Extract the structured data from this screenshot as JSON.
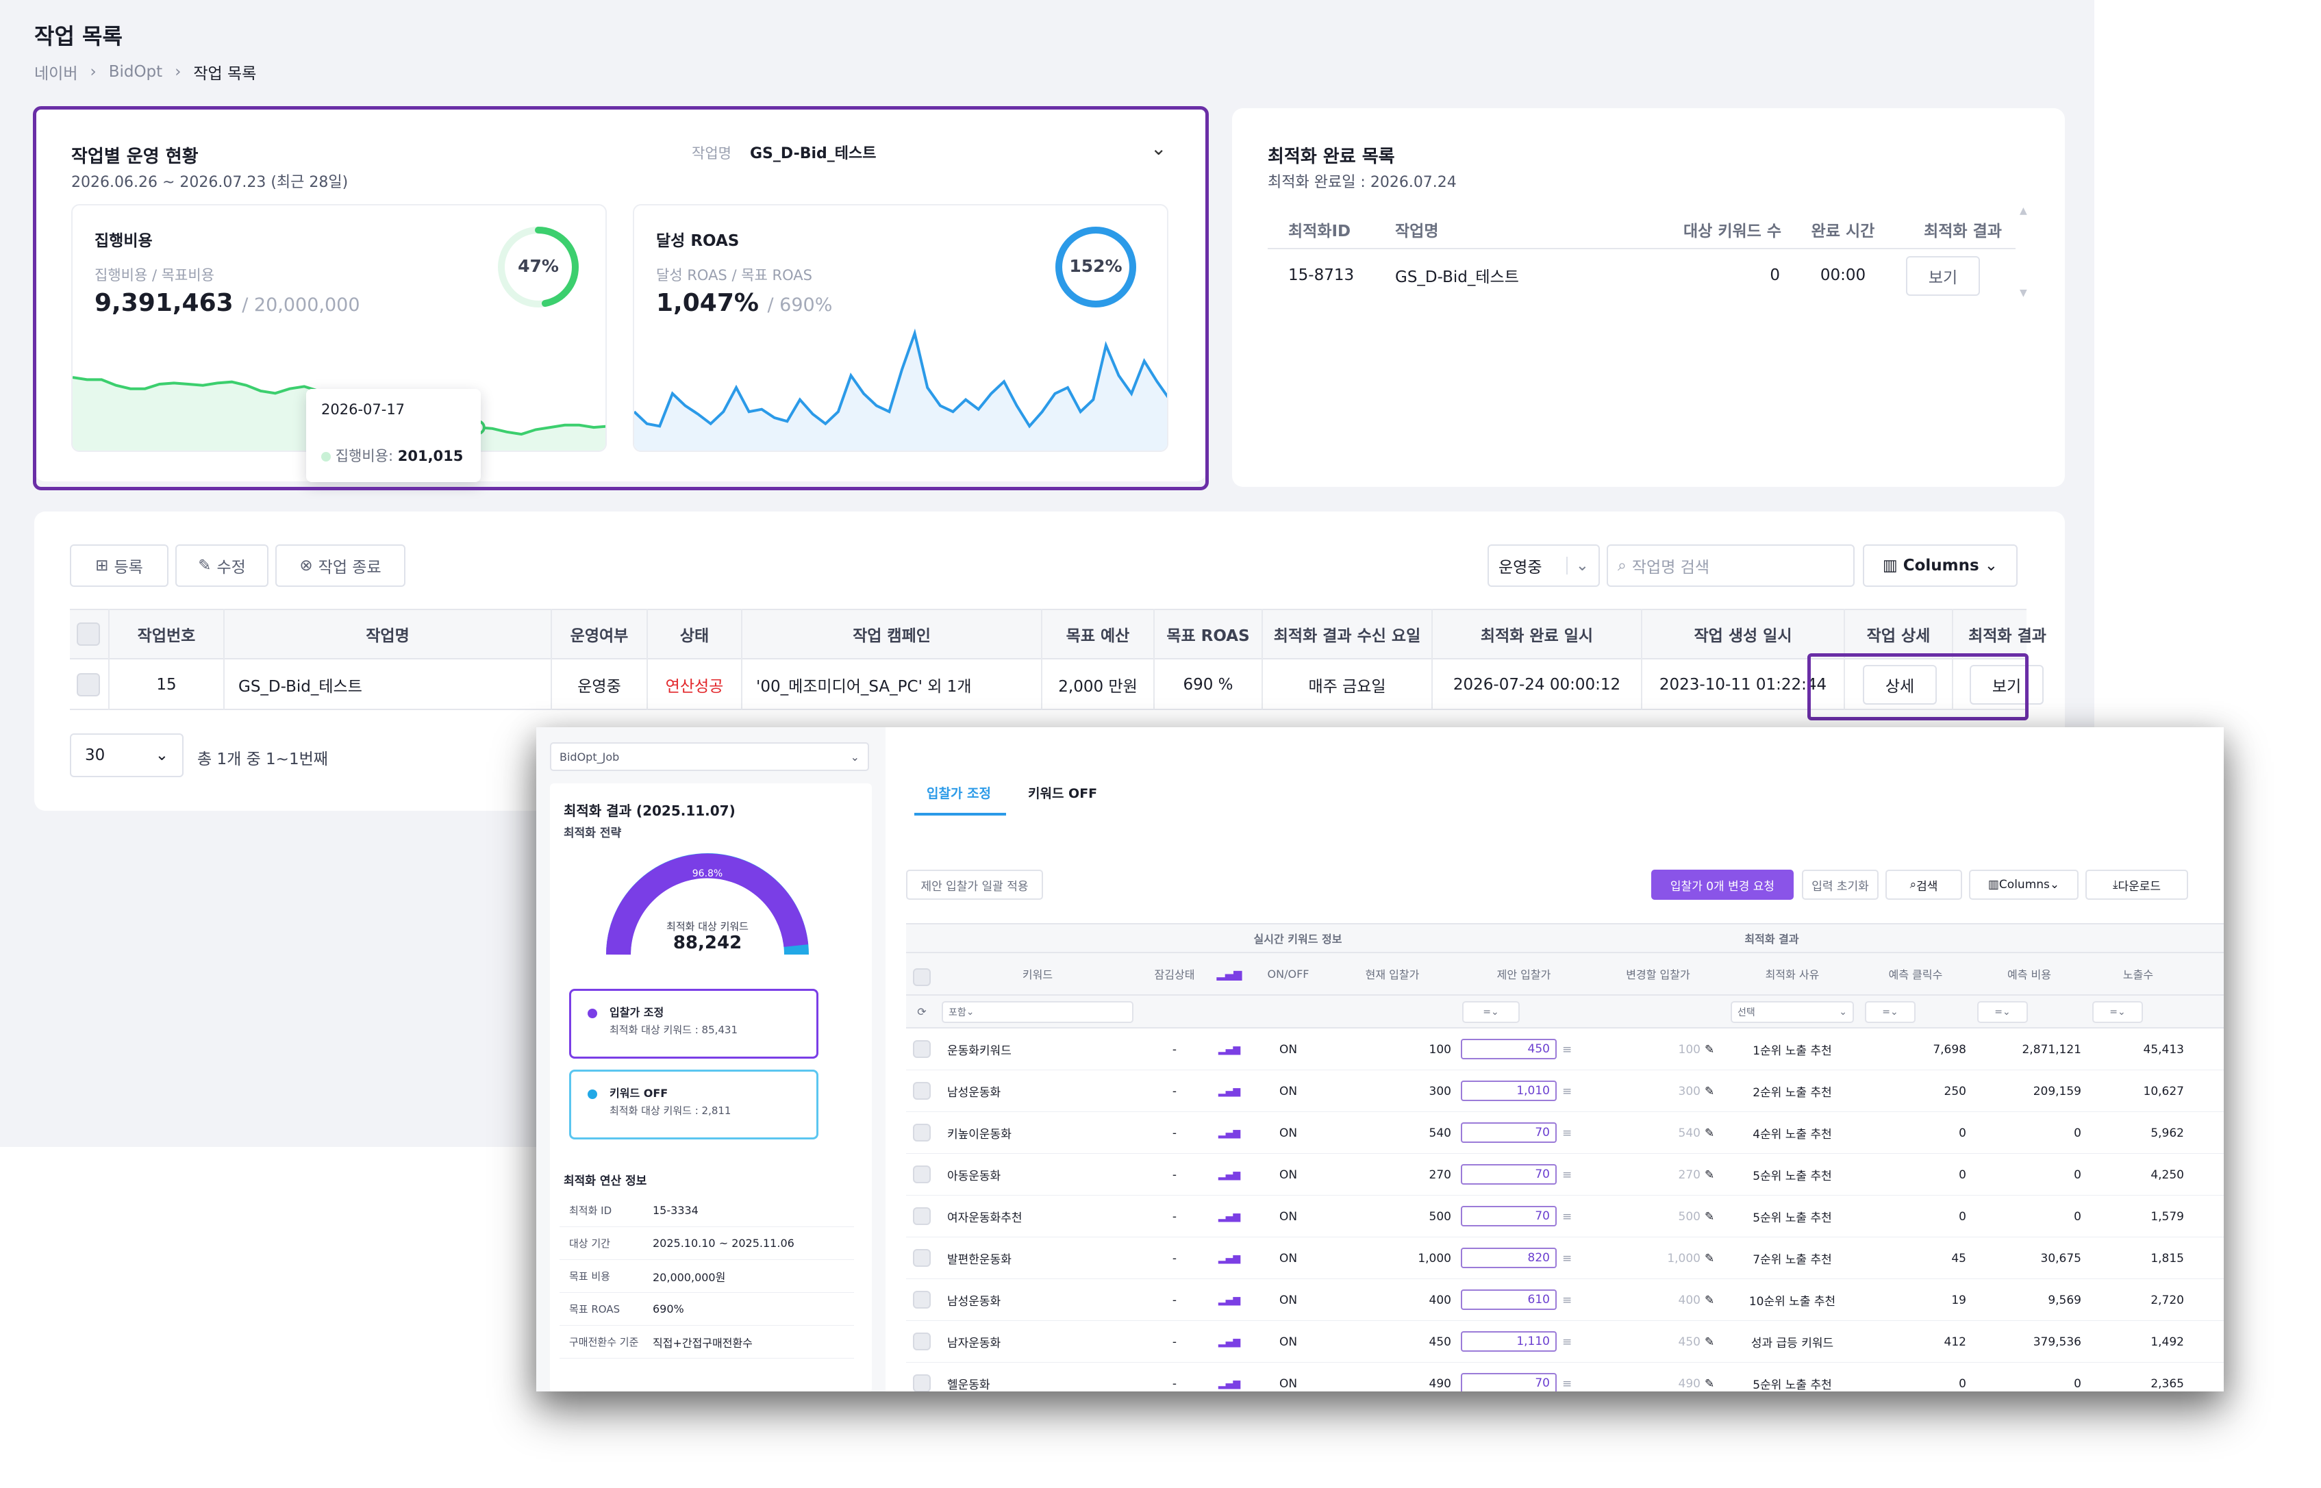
{
  "page": {
    "title": "작업 목록",
    "breadcrumb": [
      "네이버",
      "BidOpt",
      "작업 목록"
    ]
  },
  "status_card": {
    "title": "작업별 운영 현황",
    "period": "2026.06.26 ~ 2026.07.23 (최근 28일)",
    "job_label": "작업명",
    "job_value": "GS_D-Bid_테스트",
    "spend": {
      "name": "집행비용",
      "sub": "집행비용 / 목표비용",
      "value": "9,391,463",
      "target": "/ 20,000,000",
      "percent_label": "47%",
      "percent": 0.47,
      "color": "#3ccf6e",
      "trend": [
        0.62,
        0.6,
        0.6,
        0.55,
        0.52,
        0.52,
        0.56,
        0.57,
        0.56,
        0.55,
        0.57,
        0.58,
        0.55,
        0.5,
        0.48,
        0.52,
        0.54,
        0.5,
        0.35,
        0.3,
        0.33,
        0.27,
        0.22,
        0.12,
        0.2,
        0.25,
        0.22,
        0.2,
        0.18,
        0.17,
        0.14,
        0.12,
        0.16,
        0.18,
        0.2,
        0.2,
        0.18,
        0.19
      ]
    },
    "roas": {
      "name": "달성 ROAS",
      "sub": "달성 ROAS / 목표 ROAS",
      "value": "1,047%",
      "target": "/ 690%",
      "percent_label": "152%",
      "percent": 1.0,
      "color": "#2b9ae8",
      "trend": [
        0.3,
        0.2,
        0.18,
        0.45,
        0.35,
        0.28,
        0.2,
        0.3,
        0.5,
        0.3,
        0.32,
        0.25,
        0.22,
        0.4,
        0.28,
        0.2,
        0.3,
        0.6,
        0.45,
        0.35,
        0.3,
        0.65,
        0.95,
        0.5,
        0.35,
        0.3,
        0.4,
        0.32,
        0.45,
        0.55,
        0.35,
        0.18,
        0.3,
        0.45,
        0.5,
        0.3,
        0.4,
        0.85,
        0.6,
        0.45,
        0.72,
        0.55,
        0.4
      ]
    },
    "tooltip": {
      "date": "2026-07-17",
      "label": "집행비용:",
      "value": "201,015"
    }
  },
  "done_card": {
    "title": "최적화 완료 목록",
    "date": "최적화 완료일 : 2026.07.24",
    "headers": [
      "최적화ID",
      "작업명",
      "대상 키워드 수",
      "완료 시간",
      "최적화 결과"
    ],
    "row": {
      "id": "15-8713",
      "job": "GS_D-Bid_테스트",
      "count": "0",
      "time": "00:00",
      "button": "보기"
    }
  },
  "list": {
    "toolbar": {
      "register": "등록",
      "edit": "수정",
      "stop": "작업 종료",
      "filter": "운영중",
      "search_placeholder": "작업명 검색",
      "columns": "Columns"
    },
    "headers": [
      "작업번호",
      "작업명",
      "운영여부",
      "상태",
      "작업 캠페인",
      "목표 예산",
      "목표 ROAS",
      "최적화 결과 수신 요일",
      "최적화 완료 일시",
      "작업 생성 일시",
      "작업 상세",
      "최적화 결과"
    ],
    "row": {
      "no": "15",
      "name": "GS_D-Bid_테스트",
      "op": "운영중",
      "status": "연산성공",
      "campaign": "'00_메조미디어_SA_PC' 외 1개",
      "budget": "2,000 만원",
      "roas": "690 %",
      "day": "매주 금요일",
      "done": "2026-07-24 00:00:12",
      "created": "2023-10-11 01:22:44",
      "detail_btn": "상세",
      "result_btn": "보기"
    },
    "page_size": "30",
    "summary": "총 1개 중 1~1번째"
  },
  "overlay": {
    "job_select": "BidOpt_Job",
    "result_title": "최적화 결과 (2025.11.07)",
    "strategy": "최적화 전략",
    "gauge": {
      "percent_label": "96.8%",
      "percent": 0.968,
      "label": "최적화 대상 키워드",
      "value": "88,242"
    },
    "strategy_bid": {
      "name": "입찰가 조정",
      "desc": "최적화 대상 키워드 : 85,431",
      "color": "#7a3ee6"
    },
    "strategy_off": {
      "name": "키워드 OFF",
      "desc": "최적화 대상 키워드 : 2,811",
      "color": "#22a8e6"
    },
    "info_title": "최적화 연산 정보",
    "info": [
      {
        "k": "최적화 ID",
        "v": "15-3334"
      },
      {
        "k": "대상 기간",
        "v": "2025.10.10 ~ 2025.11.06"
      },
      {
        "k": "목표 비용",
        "v": "20,000,000원"
      },
      {
        "k": "목표 ROAS",
        "v": "690%"
      },
      {
        "k": "구매전환수 기준",
        "v": "직접+간접구매전환수"
      }
    ],
    "tabs": [
      "입찰가 조정",
      "키워드 OFF"
    ],
    "buttons": {
      "apply_all": "제안 입찰가 일괄 적용",
      "change_req": "입찰가 0개 변경 요청",
      "reset": "입력 초기화",
      "search": "검색",
      "columns": "Columns",
      "download": "다운로드"
    },
    "group_headers": {
      "realtime": "실시간 키워드 정보",
      "result": "최적화 결과"
    },
    "headers": [
      "키워드",
      "잠김상태",
      "ON/OFF",
      "현재 입찰가",
      "제안 입찰가",
      "변경할 입찰가",
      "최적화 사유",
      "예측 클릭수",
      "예측 비용",
      "노출수"
    ],
    "filters": {
      "keyword": "포함",
      "reason": "선택",
      "eq": "="
    },
    "rows": [
      {
        "kw": "운동화키워드",
        "lock": "-",
        "on": "ON",
        "cur": "100",
        "sug": "450",
        "chg": "100",
        "reason": "1순위 노출 추천",
        "clk": "7,698",
        "cost": "2,871,121",
        "imp": "45,413"
      },
      {
        "kw": "남성운동화",
        "lock": "-",
        "on": "ON",
        "cur": "300",
        "sug": "1,010",
        "chg": "300",
        "reason": "2순위 노출 추천",
        "clk": "250",
        "cost": "209,159",
        "imp": "10,627"
      },
      {
        "kw": "키높이운동화",
        "lock": "-",
        "on": "ON",
        "cur": "540",
        "sug": "70",
        "chg": "540",
        "reason": "4순위 노출 추천",
        "clk": "0",
        "cost": "0",
        "imp": "5,962"
      },
      {
        "kw": "아동운동화",
        "lock": "-",
        "on": "ON",
        "cur": "270",
        "sug": "70",
        "chg": "270",
        "reason": "5순위 노출 추천",
        "clk": "0",
        "cost": "0",
        "imp": "4,250"
      },
      {
        "kw": "여자운동화추천",
        "lock": "-",
        "on": "ON",
        "cur": "500",
        "sug": "70",
        "chg": "500",
        "reason": "5순위 노출 추천",
        "clk": "0",
        "cost": "0",
        "imp": "1,579"
      },
      {
        "kw": "발편한운동화",
        "lock": "-",
        "on": "ON",
        "cur": "1,000",
        "sug": "820",
        "chg": "1,000",
        "reason": "7순위 노출 추천",
        "clk": "45",
        "cost": "30,675",
        "imp": "1,815"
      },
      {
        "kw": "남성운동화",
        "lock": "-",
        "on": "ON",
        "cur": "400",
        "sug": "610",
        "chg": "400",
        "reason": "10순위 노출 추천",
        "clk": "19",
        "cost": "9,569",
        "imp": "2,720"
      },
      {
        "kw": "남자운동화",
        "lock": "-",
        "on": "ON",
        "cur": "450",
        "sug": "1,110",
        "chg": "450",
        "reason": "성과 급등 키워드",
        "clk": "412",
        "cost": "379,536",
        "imp": "1,492"
      },
      {
        "kw": "헬운동화",
        "lock": "-",
        "on": "ON",
        "cur": "490",
        "sug": "70",
        "chg": "490",
        "reason": "5순위 노출 추천",
        "clk": "0",
        "cost": "0",
        "imp": "2,365"
      }
    ],
    "colors": {
      "accent": "#7b3fe4",
      "tab": "#2b9ae8"
    }
  }
}
